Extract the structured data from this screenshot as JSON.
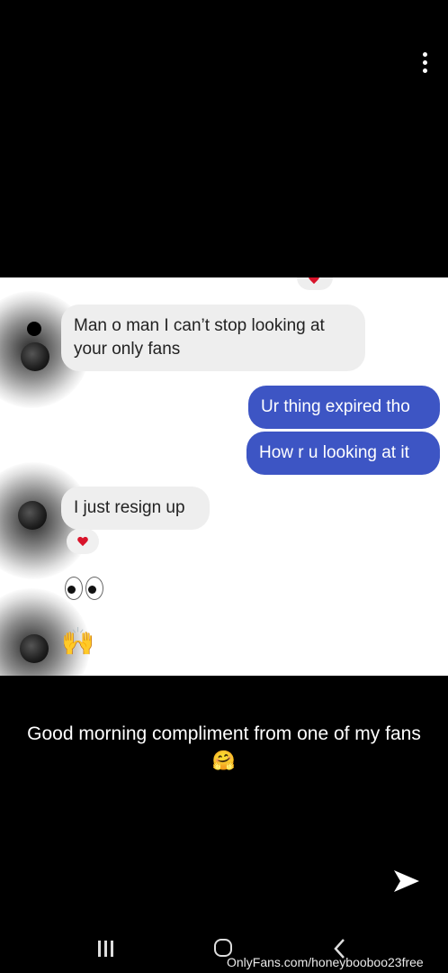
{
  "toolbar": {
    "menu_icon": "more-vertical-icon"
  },
  "chat": {
    "messages": [
      {
        "from": "them",
        "text": "Man o man I can’t stop looking at your only fans"
      },
      {
        "from": "me",
        "text": "Ur thing expired tho"
      },
      {
        "from": "me",
        "text": "How r u looking at it"
      },
      {
        "from": "them",
        "text": "I just resign up"
      }
    ],
    "reaction": "heart",
    "emoji_eyes": "eyes",
    "emoji_hands": "🙌"
  },
  "caption": {
    "text": "Good morning compliment from one of my fans 🤗"
  },
  "actions": {
    "send_icon": "send-arrow-icon"
  },
  "navbar": {
    "recents_icon": "recents-icon",
    "home_icon": "home-icon",
    "back_icon": "back-icon"
  },
  "watermark": {
    "text": "OnlyFans.com/honeybooboo23free"
  },
  "colors": {
    "outgoing_bubble": "#3d55c4",
    "incoming_bubble": "#eeeeee",
    "heart": "#d8132a",
    "background": "#000000"
  }
}
